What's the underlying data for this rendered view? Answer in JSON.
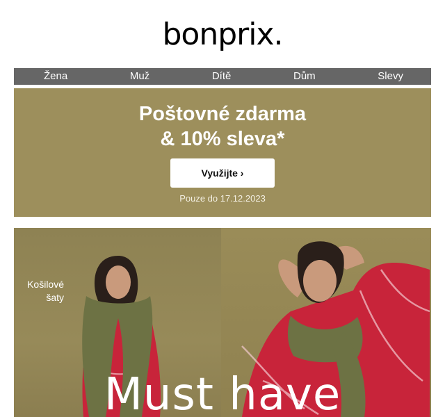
{
  "header": {
    "logo": "bonprix."
  },
  "nav": {
    "items": [
      "Žena",
      "Muž",
      "Dítě",
      "Dům",
      "Slevy"
    ]
  },
  "promo": {
    "title_line1": "Poštovné zdarma",
    "title_line2": "& 10% sleva*",
    "cta": "Využijte ›",
    "note": "Pouze do 17.12.2023"
  },
  "hero": {
    "caption_line1": "Košilové",
    "caption_line2": "šaty",
    "headline": "Must have"
  },
  "colors": {
    "promo_bg": "#9d8f5c",
    "nav_bg": "#666666",
    "dress_red": "#c8243a",
    "scarf_green": "#6d7244"
  }
}
